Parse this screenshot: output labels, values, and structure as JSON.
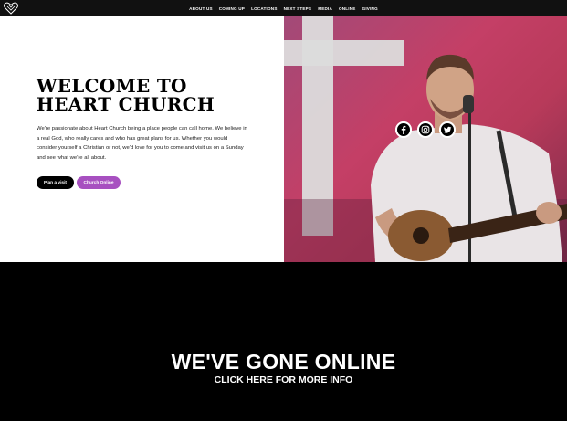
{
  "brand": {
    "logo_icon": "heart-church-logo-icon"
  },
  "nav": {
    "items": [
      {
        "label": "ABOUT US"
      },
      {
        "label": "COMING UP"
      },
      {
        "label": "LOCATIONS"
      },
      {
        "label": "NEXT STEPS"
      },
      {
        "label": "MEDIA"
      },
      {
        "label": "ONLINE"
      },
      {
        "label": "GIVING"
      }
    ]
  },
  "hero": {
    "title_line1": "WELCOME TO",
    "title_line2": "HEART CHURCH",
    "body": "We're passionate about Heart Church being a place people can call home. We believe in a real God, who really cares and who has great plans for us. Whether you would consider yourself a Christian or not, we'd love for you to come and visit us on a Sunday and see what we're all about.",
    "btn_visit": "Plan a visit",
    "btn_online": "Church Online"
  },
  "social": [
    "facebook-icon",
    "instagram-icon",
    "twitter-icon"
  ],
  "banner": {
    "title": "WE'VE GONE ONLINE",
    "subtitle": "CLICK HERE FOR MORE INFO"
  },
  "colors": {
    "nav_bg": "#111111",
    "accent_purple": "#a750c0",
    "photo_tint": "#c43f66"
  }
}
